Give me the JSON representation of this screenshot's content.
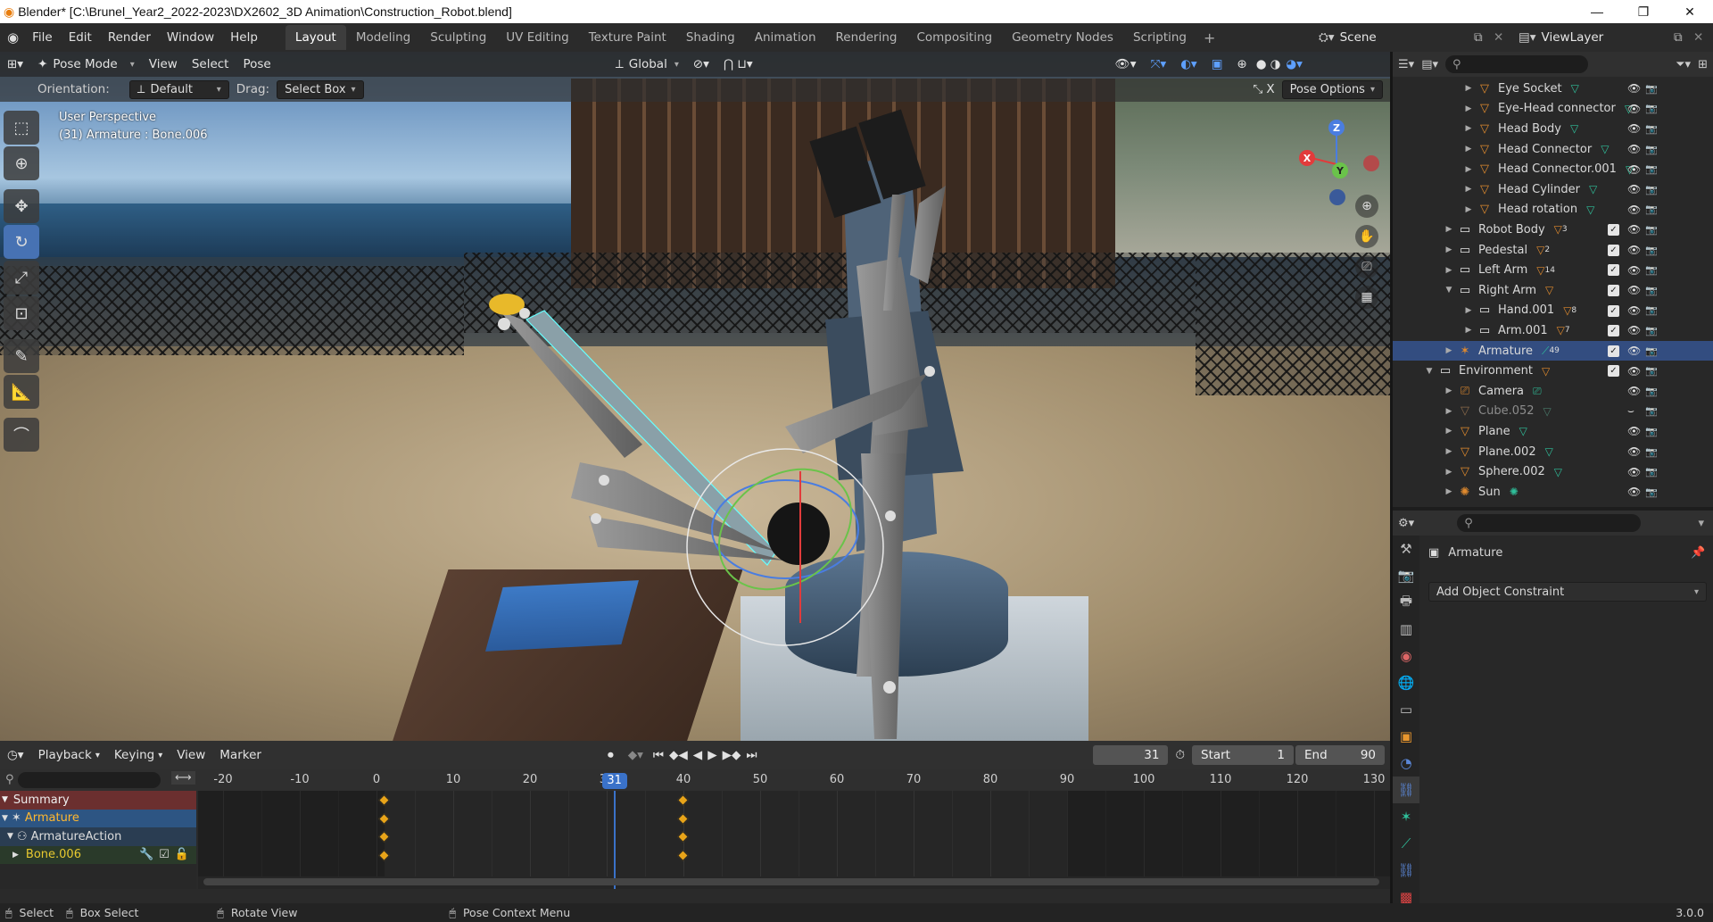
{
  "window": {
    "title": "Blender* [C:\\Brunel_Year2_2022-2023\\DX2602_3D Animation\\Construction_Robot.blend]"
  },
  "menu": [
    "File",
    "Edit",
    "Render",
    "Window",
    "Help"
  ],
  "workspaces": [
    "Layout",
    "Modeling",
    "Sculpting",
    "UV Editing",
    "Texture Paint",
    "Shading",
    "Animation",
    "Rendering",
    "Compositing",
    "Geometry Nodes",
    "Scripting"
  ],
  "active_workspace": "Layout",
  "scene": {
    "name": "Scene",
    "view_layer": "ViewLayer"
  },
  "viewport": {
    "mode": "Pose Mode",
    "menus": [
      "View",
      "Select",
      "Pose"
    ],
    "transform_orientation": "Global",
    "orientation_label": "Orientation:",
    "orientation_value": "Default",
    "drag_label": "Drag:",
    "drag_value": "Select Box",
    "pose_options": "Pose Options",
    "x_mirror": "X",
    "overlay_line1": "User Perspective",
    "overlay_line2": "(31) Armature : Bone.006",
    "gizmo": {
      "x": "X",
      "y": "Y",
      "z": "Z"
    }
  },
  "outliner": {
    "rows": [
      {
        "name": "Eye Socket",
        "indent": 3,
        "icon": "mesh",
        "dim": false
      },
      {
        "name": "Eye-Head connector",
        "indent": 3,
        "icon": "mesh",
        "dim": false
      },
      {
        "name": "Head Body",
        "indent": 3,
        "icon": "mesh",
        "dim": false
      },
      {
        "name": "Head Connector",
        "indent": 3,
        "icon": "mesh",
        "dim": false
      },
      {
        "name": "Head Connector.001",
        "indent": 3,
        "icon": "mesh",
        "dim": false
      },
      {
        "name": "Head Cylinder",
        "indent": 3,
        "icon": "mesh",
        "dim": false
      },
      {
        "name": "Head rotation",
        "indent": 3,
        "icon": "mesh",
        "dim": false
      },
      {
        "name": "Robot Body",
        "indent": 2,
        "icon": "collection",
        "badge": "3",
        "dim": false
      },
      {
        "name": "Pedestal",
        "indent": 2,
        "icon": "collection",
        "badge": "2",
        "dim": false
      },
      {
        "name": "Left Arm",
        "indent": 2,
        "icon": "collection",
        "badge": "14",
        "dim": false
      },
      {
        "name": "Right Arm",
        "indent": 2,
        "icon": "collection",
        "dim": false,
        "open": true
      },
      {
        "name": "Hand.001",
        "indent": 3,
        "icon": "collection",
        "badge": "8",
        "dim": false
      },
      {
        "name": "Arm.001",
        "indent": 3,
        "icon": "collection",
        "badge": "7",
        "dim": false
      },
      {
        "name": "Armature",
        "indent": 2,
        "icon": "armature",
        "badge": "49",
        "dim": false,
        "selected": true
      },
      {
        "name": "Environment",
        "indent": 1,
        "icon": "collection",
        "dim": false,
        "open": true
      },
      {
        "name": "Camera",
        "indent": 2,
        "icon": "camera",
        "dim": false
      },
      {
        "name": "Cube.052",
        "indent": 2,
        "icon": "mesh",
        "dim": true
      },
      {
        "name": "Plane",
        "indent": 2,
        "icon": "mesh",
        "dim": false
      },
      {
        "name": "Plane.002",
        "indent": 2,
        "icon": "mesh",
        "dim": false
      },
      {
        "name": "Sphere.002",
        "indent": 2,
        "icon": "mesh",
        "dim": false
      },
      {
        "name": "Sun",
        "indent": 2,
        "icon": "light",
        "dim": false
      }
    ]
  },
  "properties": {
    "object": "Armature",
    "add_constraint": "Add Object Constraint"
  },
  "timeline": {
    "menus": [
      "Playback",
      "Keying",
      "View",
      "Marker"
    ],
    "current_frame": "31",
    "start_label": "Start",
    "start": "1",
    "end_label": "End",
    "end": "90",
    "ruler": [
      "-20",
      "-10",
      "0",
      "10",
      "20",
      "30",
      "40",
      "50",
      "60",
      "70",
      "80",
      "90",
      "100",
      "110",
      "120",
      "130"
    ],
    "playhead": "31",
    "channels": [
      "Summary",
      "Armature",
      "ArmatureAction",
      "Bone.006"
    ],
    "keyframes": [
      1,
      40
    ]
  },
  "status": {
    "select": "Select",
    "box_select": "Box Select",
    "rotate": "Rotate View",
    "context": "Pose Context Menu",
    "version": "3.0.0"
  },
  "colors": {
    "accent": "#4772b3",
    "keyframe": "#e8a419",
    "selection": "#334d80",
    "mesh_icon": "#e08a2e",
    "data_icon": "#2fbf9a"
  }
}
